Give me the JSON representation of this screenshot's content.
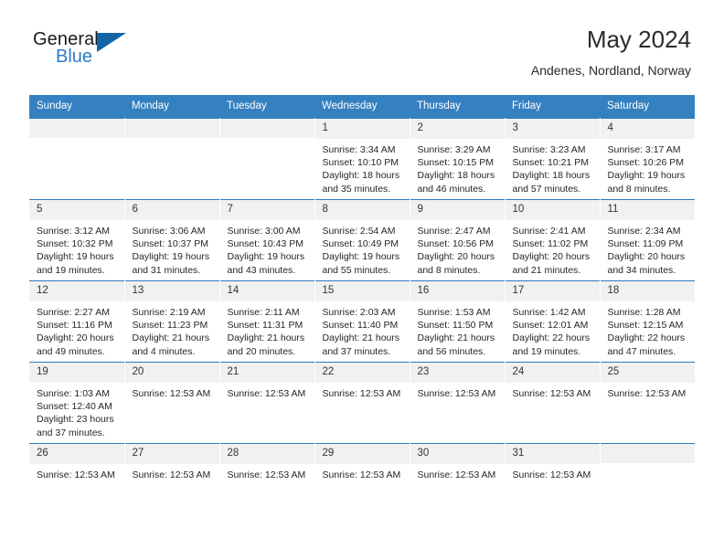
{
  "brand": {
    "name_top": "General",
    "name_bottom": "Blue",
    "triangle_color": "#1266a8",
    "blue_color": "#2b7cc4"
  },
  "header": {
    "title": "May 2024",
    "location": "Andenes, Nordland, Norway"
  },
  "theme": {
    "header_row_bg": "#3580c0",
    "row_top_border": "#2f78bb",
    "daynum_bg": "#f1f1f1",
    "text": "#262626"
  },
  "weekday_headers": [
    "Sunday",
    "Monday",
    "Tuesday",
    "Wednesday",
    "Thursday",
    "Friday",
    "Saturday"
  ],
  "weeks": [
    [
      {
        "day": "",
        "lines": []
      },
      {
        "day": "",
        "lines": []
      },
      {
        "day": "",
        "lines": []
      },
      {
        "day": "1",
        "lines": [
          "Sunrise: 3:34 AM",
          "Sunset: 10:10 PM",
          "Daylight: 18 hours",
          "and 35 minutes."
        ]
      },
      {
        "day": "2",
        "lines": [
          "Sunrise: 3:29 AM",
          "Sunset: 10:15 PM",
          "Daylight: 18 hours",
          "and 46 minutes."
        ]
      },
      {
        "day": "3",
        "lines": [
          "Sunrise: 3:23 AM",
          "Sunset: 10:21 PM",
          "Daylight: 18 hours",
          "and 57 minutes."
        ]
      },
      {
        "day": "4",
        "lines": [
          "Sunrise: 3:17 AM",
          "Sunset: 10:26 PM",
          "Daylight: 19 hours",
          "and 8 minutes."
        ]
      }
    ],
    [
      {
        "day": "5",
        "lines": [
          "Sunrise: 3:12 AM",
          "Sunset: 10:32 PM",
          "Daylight: 19 hours",
          "and 19 minutes."
        ]
      },
      {
        "day": "6",
        "lines": [
          "Sunrise: 3:06 AM",
          "Sunset: 10:37 PM",
          "Daylight: 19 hours",
          "and 31 minutes."
        ]
      },
      {
        "day": "7",
        "lines": [
          "Sunrise: 3:00 AM",
          "Sunset: 10:43 PM",
          "Daylight: 19 hours",
          "and 43 minutes."
        ]
      },
      {
        "day": "8",
        "lines": [
          "Sunrise: 2:54 AM",
          "Sunset: 10:49 PM",
          "Daylight: 19 hours",
          "and 55 minutes."
        ]
      },
      {
        "day": "9",
        "lines": [
          "Sunrise: 2:47 AM",
          "Sunset: 10:56 PM",
          "Daylight: 20 hours",
          "and 8 minutes."
        ]
      },
      {
        "day": "10",
        "lines": [
          "Sunrise: 2:41 AM",
          "Sunset: 11:02 PM",
          "Daylight: 20 hours",
          "and 21 minutes."
        ]
      },
      {
        "day": "11",
        "lines": [
          "Sunrise: 2:34 AM",
          "Sunset: 11:09 PM",
          "Daylight: 20 hours",
          "and 34 minutes."
        ]
      }
    ],
    [
      {
        "day": "12",
        "lines": [
          "Sunrise: 2:27 AM",
          "Sunset: 11:16 PM",
          "Daylight: 20 hours",
          "and 49 minutes."
        ]
      },
      {
        "day": "13",
        "lines": [
          "Sunrise: 2:19 AM",
          "Sunset: 11:23 PM",
          "Daylight: 21 hours",
          "and 4 minutes."
        ]
      },
      {
        "day": "14",
        "lines": [
          "Sunrise: 2:11 AM",
          "Sunset: 11:31 PM",
          "Daylight: 21 hours",
          "and 20 minutes."
        ]
      },
      {
        "day": "15",
        "lines": [
          "Sunrise: 2:03 AM",
          "Sunset: 11:40 PM",
          "Daylight: 21 hours",
          "and 37 minutes."
        ]
      },
      {
        "day": "16",
        "lines": [
          "Sunrise: 1:53 AM",
          "Sunset: 11:50 PM",
          "Daylight: 21 hours",
          "and 56 minutes."
        ]
      },
      {
        "day": "17",
        "lines": [
          "Sunrise: 1:42 AM",
          "Sunset: 12:01 AM",
          "Daylight: 22 hours",
          "and 19 minutes."
        ]
      },
      {
        "day": "18",
        "lines": [
          "Sunrise: 1:28 AM",
          "Sunset: 12:15 AM",
          "Daylight: 22 hours",
          "and 47 minutes."
        ]
      }
    ],
    [
      {
        "day": "19",
        "lines": [
          "Sunrise: 1:03 AM",
          "Sunset: 12:40 AM",
          "Daylight: 23 hours",
          "and 37 minutes."
        ]
      },
      {
        "day": "20",
        "lines": [
          "Sunrise: 12:53 AM"
        ]
      },
      {
        "day": "21",
        "lines": [
          "Sunrise: 12:53 AM"
        ]
      },
      {
        "day": "22",
        "lines": [
          "Sunrise: 12:53 AM"
        ]
      },
      {
        "day": "23",
        "lines": [
          "Sunrise: 12:53 AM"
        ]
      },
      {
        "day": "24",
        "lines": [
          "Sunrise: 12:53 AM"
        ]
      },
      {
        "day": "25",
        "lines": [
          "Sunrise: 12:53 AM"
        ]
      }
    ],
    [
      {
        "day": "26",
        "lines": [
          "Sunrise: 12:53 AM"
        ]
      },
      {
        "day": "27",
        "lines": [
          "Sunrise: 12:53 AM"
        ]
      },
      {
        "day": "28",
        "lines": [
          "Sunrise: 12:53 AM"
        ]
      },
      {
        "day": "29",
        "lines": [
          "Sunrise: 12:53 AM"
        ]
      },
      {
        "day": "30",
        "lines": [
          "Sunrise: 12:53 AM"
        ]
      },
      {
        "day": "31",
        "lines": [
          "Sunrise: 12:53 AM"
        ]
      },
      {
        "day": "",
        "lines": []
      }
    ]
  ]
}
